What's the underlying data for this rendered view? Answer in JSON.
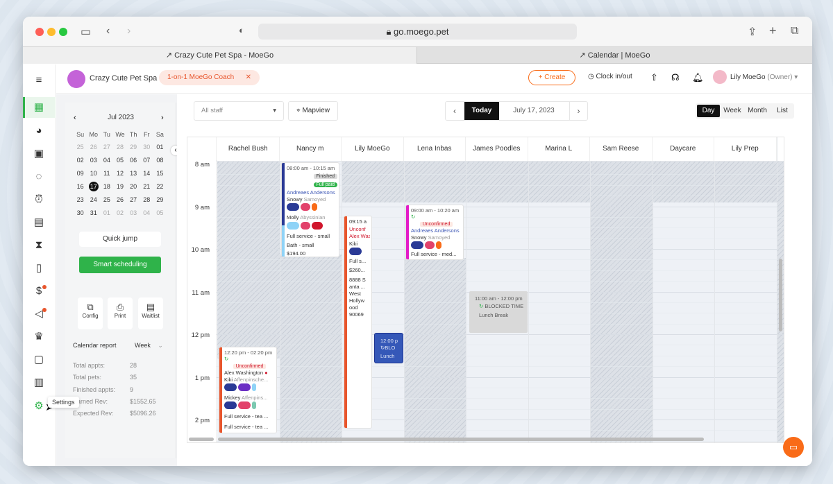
{
  "browser": {
    "url": "go.moego.pet",
    "tabs": [
      "Crazy Cute Pet Spa - MoeGo",
      "Calendar | MoeGo"
    ]
  },
  "header": {
    "business": "Crazy Cute Pet Spa",
    "coach": "1-on-1 MoeGo Coach",
    "create": "+ Create",
    "clock": "Clock in/out",
    "user": "Lily MoeGo",
    "role": "(Owner)"
  },
  "minical": {
    "month": "Jul 2023",
    "weekdays": [
      "Su",
      "Mo",
      "Tu",
      "We",
      "Th",
      "Fr",
      "Sa"
    ],
    "weeks": [
      [
        "25",
        "26",
        "27",
        "28",
        "29",
        "30",
        "01"
      ],
      [
        "02",
        "03",
        "04",
        "05",
        "06",
        "07",
        "08"
      ],
      [
        "09",
        "10",
        "11",
        "12",
        "13",
        "14",
        "15"
      ],
      [
        "16",
        "17",
        "18",
        "19",
        "20",
        "21",
        "22"
      ],
      [
        "23",
        "24",
        "25",
        "26",
        "27",
        "28",
        "29"
      ],
      [
        "30",
        "31",
        "01",
        "02",
        "03",
        "04",
        "05"
      ]
    ],
    "selected": "17"
  },
  "left": {
    "quick_jump": "Quick jump",
    "smart": "Smart scheduling",
    "tools": [
      "Config",
      "Print",
      "Waitlist"
    ],
    "report_title": "Calendar report",
    "report_period": "Week",
    "stats": [
      {
        "label": "Total appts:",
        "value": "28"
      },
      {
        "label": "Total pets:",
        "value": "35"
      },
      {
        "label": "Finished appts:",
        "value": "9"
      },
      {
        "label": "Earned Rev:",
        "value": "$1552.65"
      },
      {
        "label": "Expected Rev:",
        "value": "$5096.26"
      }
    ],
    "tooltip": "Settings"
  },
  "toolbar": {
    "staff": "All staff",
    "mapview": "Mapview",
    "today": "Today",
    "date": "July 17, 2023",
    "views": [
      "Day",
      "Week",
      "Month",
      "List"
    ],
    "active_view": "Day"
  },
  "columns": [
    "Rachel Bush",
    "Nancy m",
    "Lily MoeGo",
    "Lena Inbas",
    "James Poodles",
    "Marina L",
    "Sam Reese",
    "Daycare",
    "Lily Prep"
  ],
  "times": [
    "8 am",
    "9 am",
    "10 am",
    "11 am",
    "12 pm",
    "1 pm",
    "2 pm"
  ],
  "appointments": {
    "nancy": {
      "time": "08:00 am - 10:15 am",
      "status": "Finished",
      "paid": "Full paid",
      "client": "Andreaes Andersons",
      "pet1": "Snowy",
      "breed1": "Samoyed",
      "pet2": "Molly",
      "breed2": "Abyssinian",
      "svc1": "Full service - small",
      "svc2": "Bath - small",
      "price": "$194.00"
    },
    "lily": {
      "time": "09:15 a",
      "status": "Unconf",
      "client": "Alex Was",
      "pet": "Kiki",
      "svc": "Full s...",
      "price": "$260...",
      "addr1": "8888 S",
      "addr2": "anta ...",
      "addr3": "West",
      "addr4": "Hollyw",
      "addr5": "ood",
      "addr6": "90069"
    },
    "lena": {
      "time": "09:00 am - 10:20 am",
      "status": "Unconfirmed",
      "client": "Andreaes Andersons",
      "pet": "Snowy",
      "breed": "Samoyed",
      "svc": "Full service - med..."
    },
    "james": {
      "time": "11:00 am - 12:00 pm",
      "label": "BLOCKED TIME",
      "note": "Lunch Break"
    },
    "lilylunch": {
      "time": "12:00 p",
      "label": "BLO",
      "note": "Lunch"
    },
    "rachel": {
      "time": "12:20 pm - 02:20 pm",
      "status": "Unconfirmed",
      "client": "Alex Washington",
      "pet1": "Kiki",
      "breed1": "Affenpinsche...",
      "pet2": "Mickey",
      "breed2": "Affenpins...",
      "svc1": "Full service - tea ...",
      "svc2": "Full service - tea ..."
    }
  },
  "colors": {
    "accent": "#2fb34a",
    "brand": "#f96b18",
    "dark": "#111111"
  }
}
